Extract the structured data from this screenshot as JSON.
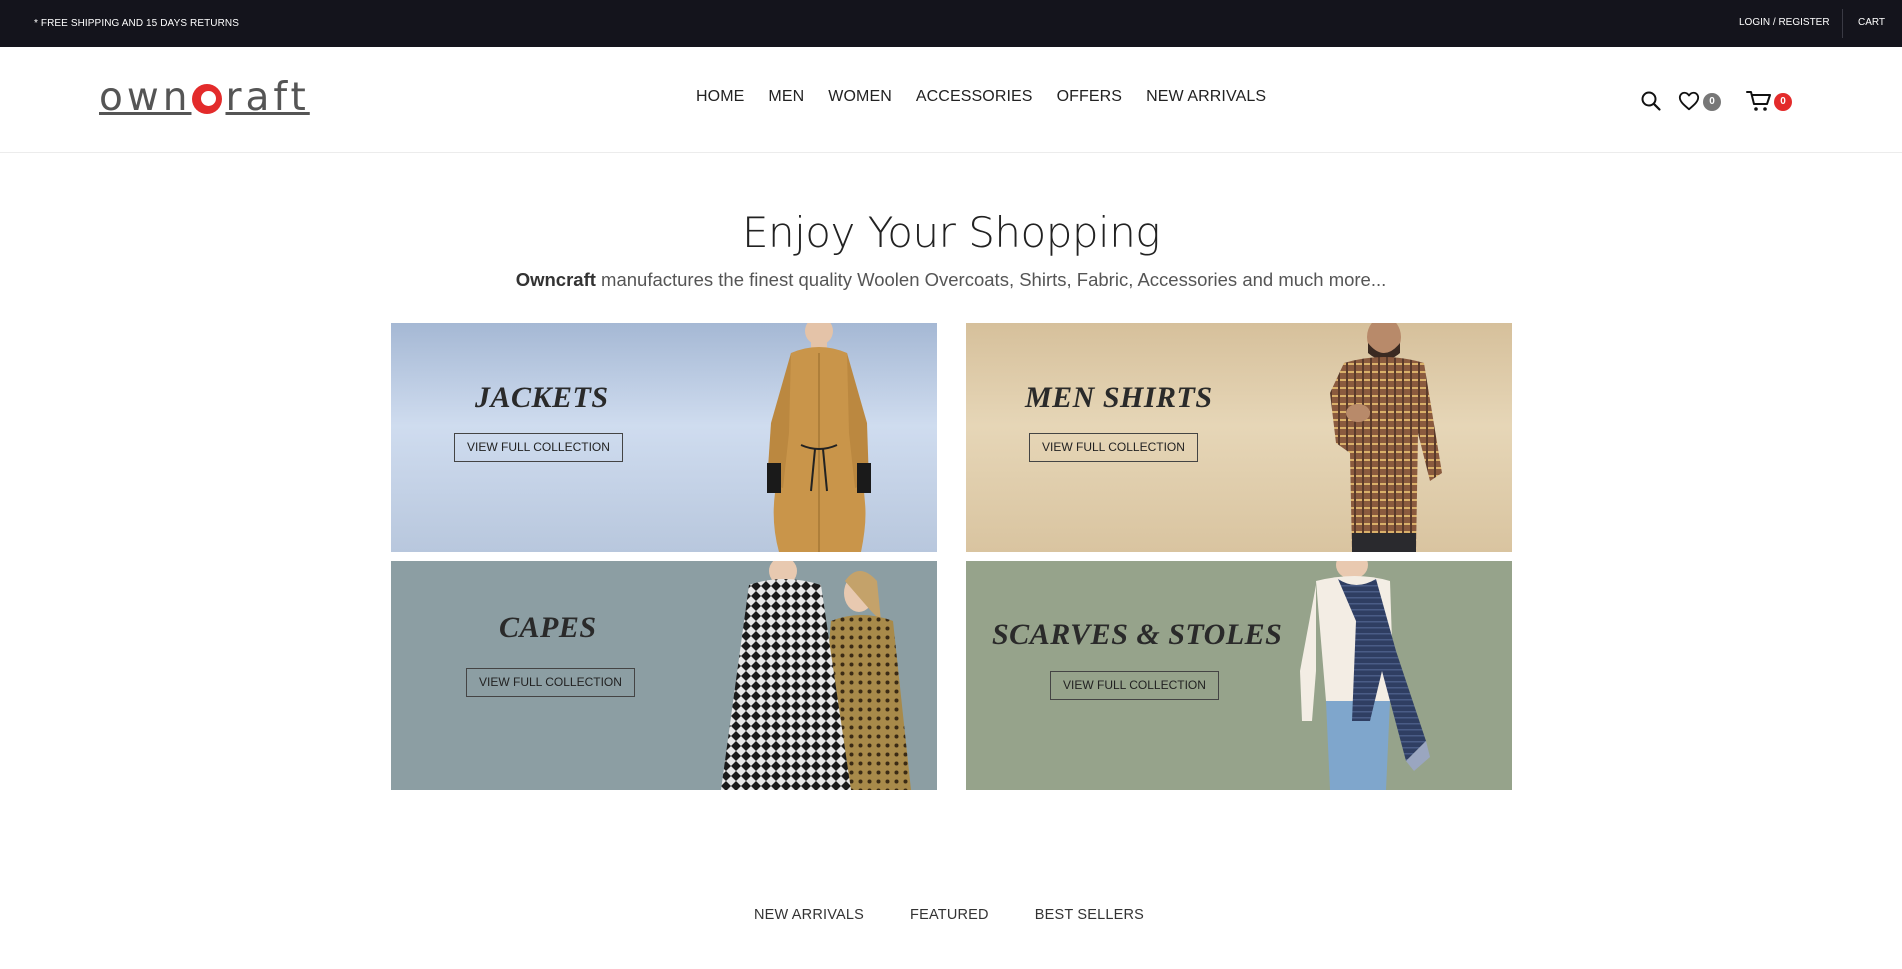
{
  "topbar": {
    "promo": "* FREE SHIPPING AND 15 DAYS RETURNS",
    "login": "LOGIN / REGISTER",
    "cart": "CART"
  },
  "header": {
    "logo_text_left": "own",
    "logo_text_right": "raft",
    "nav": [
      "HOME",
      "MEN",
      "WOMEN",
      "ACCESSORIES",
      "OFFERS",
      "NEW ARRIVALS"
    ],
    "wishlist_count": "0",
    "cart_count": "0"
  },
  "hero": {
    "title": "Enjoy Your Shopping",
    "brand": "Owncraft",
    "subtitle": " manufactures the finest quality Woolen Overcoats, Shirts, Fabric, Accessories and much more..."
  },
  "banners": [
    {
      "title": "JACKETS",
      "button": "VIEW FULL COLLECTION"
    },
    {
      "title": "MEN SHIRTS",
      "button": "VIEW FULL COLLECTION"
    },
    {
      "title": "CAPES",
      "button": "VIEW FULL COLLECTION"
    },
    {
      "title": "SCARVES & STOLES",
      "button": "VIEW FULL COLLECTION"
    }
  ],
  "tabs": [
    "NEW ARRIVALS",
    "FEATURED",
    "BEST SELLERS"
  ],
  "colors": {
    "topbar_bg": "#14141c",
    "accent_red": "#e32b2b",
    "wishlist_badge": "#777777"
  },
  "icons": [
    "search-icon",
    "heart-icon",
    "cart-icon"
  ]
}
